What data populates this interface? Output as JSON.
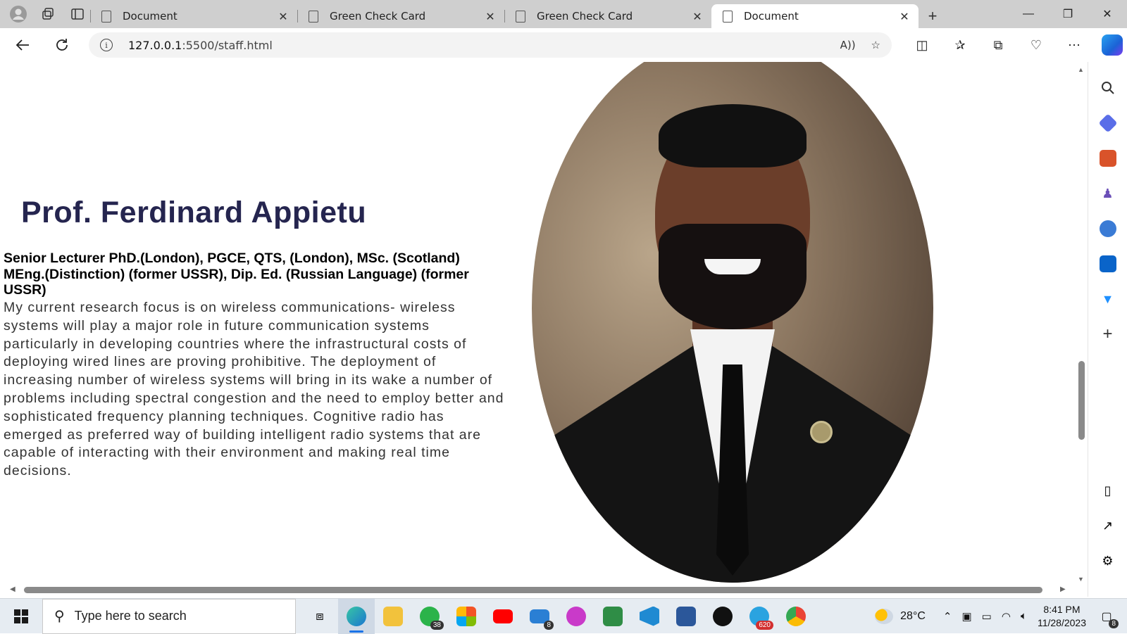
{
  "browser": {
    "tabs": [
      {
        "label": "Document",
        "active": false
      },
      {
        "label": "Green Check Card",
        "active": false
      },
      {
        "label": "Green Check Card",
        "active": false
      },
      {
        "label": "Document",
        "active": true
      }
    ],
    "url_host": "127.0.0.1",
    "url_rest": ":5500/staff.html"
  },
  "page": {
    "name": "Prof. Ferdinard Appietu",
    "credentials": "Senior Lecturer PhD.(London), PGCE, QTS, (London), MSc. (Scotland) MEng.(Distinction) (former USSR), Dip. Ed. (Russian Language) (former USSR)",
    "bio": "My current research focus is on wireless communications- wireless systems will play a major role in future communication systems particularly in developing countries where the infrastructural costs of deploying wired lines are proving prohibitive. The deployment of increasing number of wireless systems will bring in its wake a number of problems including spectral congestion and the need to employ better and sophisticated frequency planning techniques. Cognitive radio has emerged as preferred way of building intelligent radio systems that are capable of interacting with their environment and making real time decisions."
  },
  "taskbar": {
    "search_placeholder": "Type here to search",
    "whatsapp_badge": "38",
    "mail_badge": "8",
    "telegram_badge": "620",
    "temperature": "28°C",
    "time": "8:41 PM",
    "date": "11/28/2023",
    "notifications": "8"
  },
  "icons": [
    "profile-icon",
    "workspaces-icon",
    "tab-actions-icon",
    "back-icon",
    "refresh-icon",
    "info-icon",
    "read-aloud-icon",
    "favorite-icon",
    "split-screen-icon",
    "favorites-icon",
    "collections-icon",
    "performance-icon",
    "more-icon",
    "copilot-icon"
  ]
}
